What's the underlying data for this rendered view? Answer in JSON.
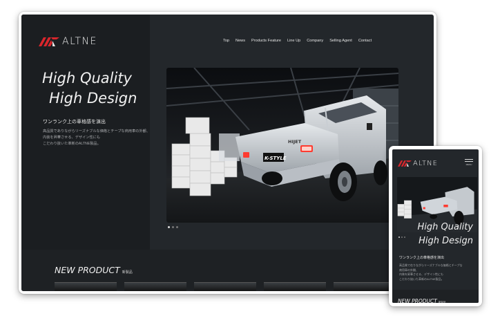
{
  "site": {
    "brand": "ALTNE",
    "nav": [
      "Top",
      "News",
      "Products Feature",
      "Line Up",
      "Company",
      "Selling Agent",
      "Contact"
    ],
    "headline_line1": "High Quality",
    "headline_line2": "High Design",
    "subhead": "ワンランク上の車格感を演出",
    "body_line1": "高品質でありながらリーズナブルな価格とチープな商用車の外観、",
    "body_line2": "内装を昇華させる、デザイン性にも",
    "body_line3": "こだわり抜いた革新のALTNE製品。",
    "new_product": "NEW PRODUCT",
    "new_product_jp": "新製品",
    "menu_label": "MENU"
  },
  "mobile": {
    "body_line1": "高品質で在りながらリーズナブルな価格とチープな",
    "body_line2": "商用車の外観、",
    "body_line3": "内装を昇華させる、デザイン性にも",
    "body_line4": "こだわり抜いた革新のALTNE製品。"
  },
  "hero": {
    "tailgate_badge": "HIJET",
    "plate_text": "K-STYLE",
    "slide_count": 3,
    "active_slide": 1
  },
  "colors": {
    "background": "#23272b",
    "panel_dark": "#1b1e21",
    "logo_red": "#d9262c",
    "text_light": "#f0f0f0",
    "text_muted": "#a8aaad"
  }
}
